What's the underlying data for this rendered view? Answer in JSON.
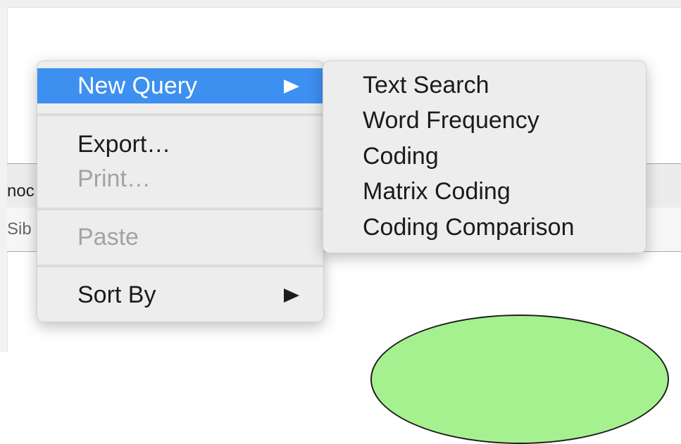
{
  "background": {
    "header_text": "noc",
    "sub_text": "Sib"
  },
  "menu": {
    "items": [
      {
        "label": "New Query",
        "state": "highlighted",
        "has_submenu": true
      },
      {
        "label": "Export…",
        "state": "enabled",
        "has_submenu": false
      },
      {
        "label": "Print…",
        "state": "disabled",
        "has_submenu": false
      },
      {
        "label": "Paste",
        "state": "disabled",
        "has_submenu": false
      },
      {
        "label": "Sort By",
        "state": "enabled",
        "has_submenu": true
      }
    ]
  },
  "submenu": {
    "items": [
      {
        "label": "Text Search"
      },
      {
        "label": "Word Frequency"
      },
      {
        "label": "Coding"
      },
      {
        "label": "Matrix Coding"
      },
      {
        "label": "Coding Comparison"
      }
    ]
  },
  "colors": {
    "highlight": "#3d8ff0",
    "ellipse_fill": "#a6f18f"
  }
}
